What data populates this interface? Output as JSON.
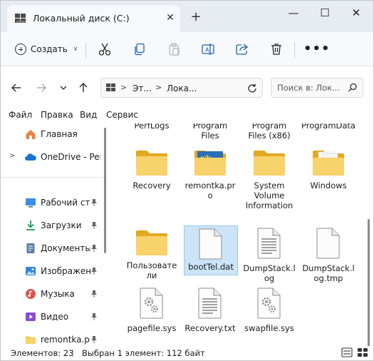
{
  "window": {
    "tab_title": "Локальный диск (C:)",
    "close_tab": "✕",
    "new_tab": "+",
    "minimize": "—",
    "maximize": "☐",
    "close": "✕"
  },
  "commandbar": {
    "create_label": "Создать",
    "icons": [
      "cut-icon",
      "copy-icon",
      "paste-icon",
      "rename-icon",
      "share-icon",
      "delete-icon"
    ],
    "more": "•••"
  },
  "address": {
    "crumbs": [
      "Эт...",
      "Лока..."
    ],
    "search_placeholder": "Поиск в: Лок..."
  },
  "menu": [
    "Файл",
    "Правка",
    "Вид",
    "Сервис"
  ],
  "sidebar": {
    "items": [
      {
        "label": "Главная",
        "icon": "home-icon",
        "expandable": false,
        "pinned": false
      },
      {
        "label": "OneDrive - Perso",
        "icon": "onedrive-icon",
        "expandable": true,
        "pinned": false
      },
      {
        "label": "Рабочий стол",
        "icon": "desktop-icon",
        "expandable": false,
        "pinned": true
      },
      {
        "label": "Загрузки",
        "icon": "downloads-icon",
        "expandable": false,
        "pinned": true
      },
      {
        "label": "Документы",
        "icon": "documents-icon",
        "expandable": false,
        "pinned": true
      },
      {
        "label": "Изображения",
        "icon": "pictures-icon",
        "expandable": false,
        "pinned": true
      },
      {
        "label": "Музыка",
        "icon": "music-icon",
        "expandable": false,
        "pinned": true
      },
      {
        "label": "Видео",
        "icon": "video-icon",
        "expandable": false,
        "pinned": true
      },
      {
        "label": "remontka.pro",
        "icon": "folder-icon",
        "expandable": false,
        "pinned": true
      }
    ]
  },
  "files": [
    {
      "name": "PerfLogs",
      "type": "folder"
    },
    {
      "name": "Program Files",
      "type": "folder"
    },
    {
      "name": "Program Files (x86)",
      "type": "folder"
    },
    {
      "name": "ProgramData",
      "type": "folder"
    },
    {
      "name": "Recovery",
      "type": "folder"
    },
    {
      "name": "remontka.pro",
      "type": "folder-image"
    },
    {
      "name": "System Volume Information",
      "type": "folder"
    },
    {
      "name": "Windows",
      "type": "folder-docs"
    },
    {
      "name": "Пользователи",
      "type": "folder"
    },
    {
      "name": "bootTel.dat",
      "type": "blank",
      "selected": true
    },
    {
      "name": "DumpStack.log",
      "type": "text"
    },
    {
      "name": "DumpStack.log.tmp",
      "type": "blank"
    },
    {
      "name": "pagefile.sys",
      "type": "system"
    },
    {
      "name": "Recovery.txt",
      "type": "text"
    },
    {
      "name": "swapfile.sys",
      "type": "system"
    }
  ],
  "status": {
    "count": "Элементов: 23",
    "selection": "Выбран 1 элемент: 112 байт"
  },
  "colors": {
    "folder": "#f5c342",
    "folder_dark": "#e3a822",
    "selection": "#cce4f7",
    "accent": "#0067c0"
  }
}
